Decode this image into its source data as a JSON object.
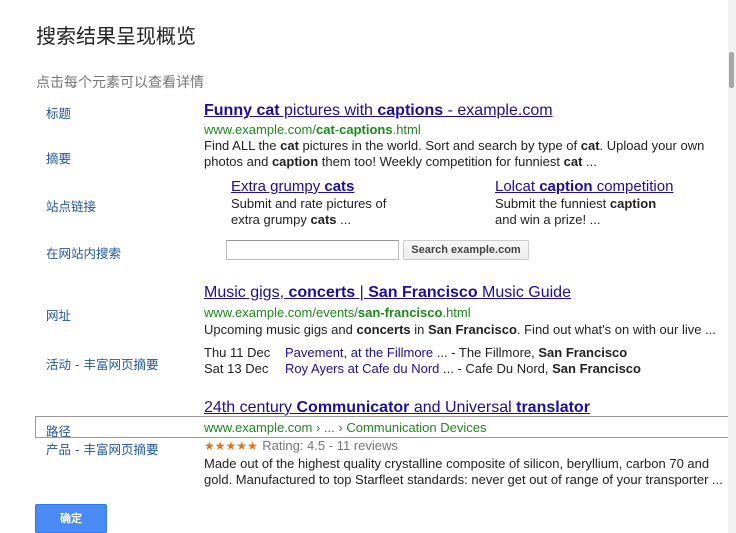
{
  "dialog": {
    "title": "搜索结果呈现概览",
    "subtitle": "点击每个元素可以查看详情",
    "ok_label": "确定"
  },
  "labels": {
    "title": "标题",
    "snippet": "摘要",
    "sitelinks": "站点链接",
    "site_search": "在网站内搜索",
    "url": "网址",
    "events": "活动 - 丰富网页摘要",
    "breadcrumb": "路径",
    "product": "产品 - 丰富网页摘要"
  },
  "result1": {
    "title_parts": [
      "Funny cat",
      " pictures with ",
      "captions",
      " - example.com"
    ],
    "url_parts": [
      "www.example.com/",
      "cat",
      "-",
      "captions",
      ".html"
    ],
    "snippet_line1": [
      "Find ALL the ",
      "cat",
      " pictures in the world. Sort and search by type of ",
      "cat",
      ". Upload your own"
    ],
    "snippet_line2": [
      "photos and ",
      "caption",
      " them too! Weekly competition for funniest ",
      "cat",
      " ..."
    ],
    "sitelinks": [
      {
        "title_parts": [
          "Extra grumpy ",
          "cats"
        ],
        "desc1": [
          "Submit and rate pictures of"
        ],
        "desc2": [
          "extra grumpy ",
          "cats",
          " ..."
        ]
      },
      {
        "title_parts": [
          "Lolcat ",
          "caption",
          " competition"
        ],
        "desc1": [
          "Submit the funniest ",
          "caption"
        ],
        "desc2": [
          "and win a prize! ..."
        ]
      }
    ],
    "search_placeholder": "",
    "search_button": "Search example.com"
  },
  "result2": {
    "title_parts": [
      "Music gigs, ",
      "concerts",
      " | ",
      "San Francisco",
      " Music Guide"
    ],
    "url_parts": [
      "www.example.com/events/",
      "san-francisco",
      ".html"
    ],
    "snippet": [
      "Upcoming music gigs and ",
      "concerts",
      " in ",
      "San Francisco",
      ". Find out what's on with our live ..."
    ],
    "events": [
      {
        "date": "Thu 11 Dec",
        "name": "Pavement, at the Fillmore",
        "venue_prefix": " ... - The Fillmore, ",
        "city": "San Francisco"
      },
      {
        "date": "Sat 13 Dec",
        "name": "Roy Ayers at Cafe du Nord",
        "venue_prefix": " ... - Cafe Du Nord, ",
        "city": "San Francisco"
      }
    ]
  },
  "result3": {
    "title_parts": [
      "24th century ",
      "Communicator",
      " and Universal ",
      "translator"
    ],
    "breadcrumb": [
      "www.example.com",
      " › ... › ",
      "Communication Devices"
    ],
    "stars": "★★★★★",
    "rating": "Rating: 4.5 - 11 reviews",
    "rating_value": 4.5,
    "snippet_line1": "Made out of the highest quality crystalline composite of silicon, beryllium, carbon 70 and",
    "snippet_line2": "gold. Manufactured to top Starfleet standards: never get out of range of your transporter ..."
  },
  "colors": {
    "link": "#1a0dab",
    "url": "#1a8a1a",
    "label": "#2255aa",
    "star": "#e7711b",
    "ok_button": "#4a8af4"
  }
}
